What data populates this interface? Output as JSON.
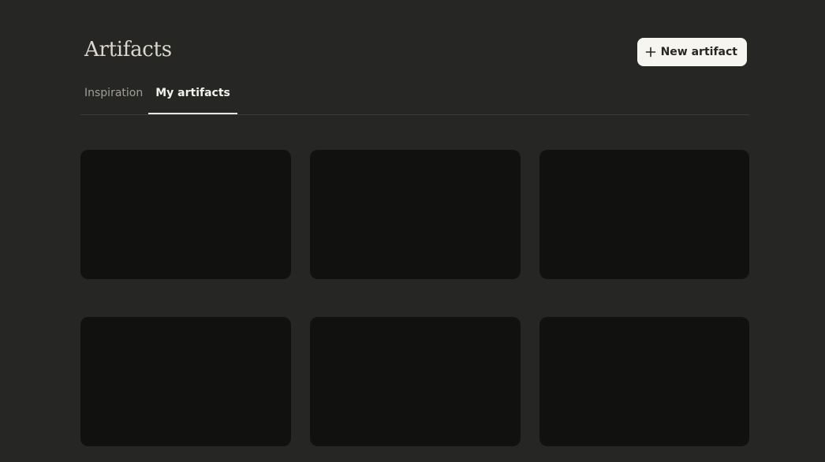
{
  "header": {
    "title": "Artifacts",
    "new_button_label": "New artifact",
    "new_button_icon": "plus-icon"
  },
  "tabs": [
    {
      "label": "Inspiration",
      "active": false
    },
    {
      "label": "My artifacts",
      "active": true
    }
  ],
  "artifact_cards_count": 6,
  "colors": {
    "background": "#262624",
    "card": "#111110",
    "button_bg": "#f7f5f0",
    "divider": "#3d3c39"
  }
}
